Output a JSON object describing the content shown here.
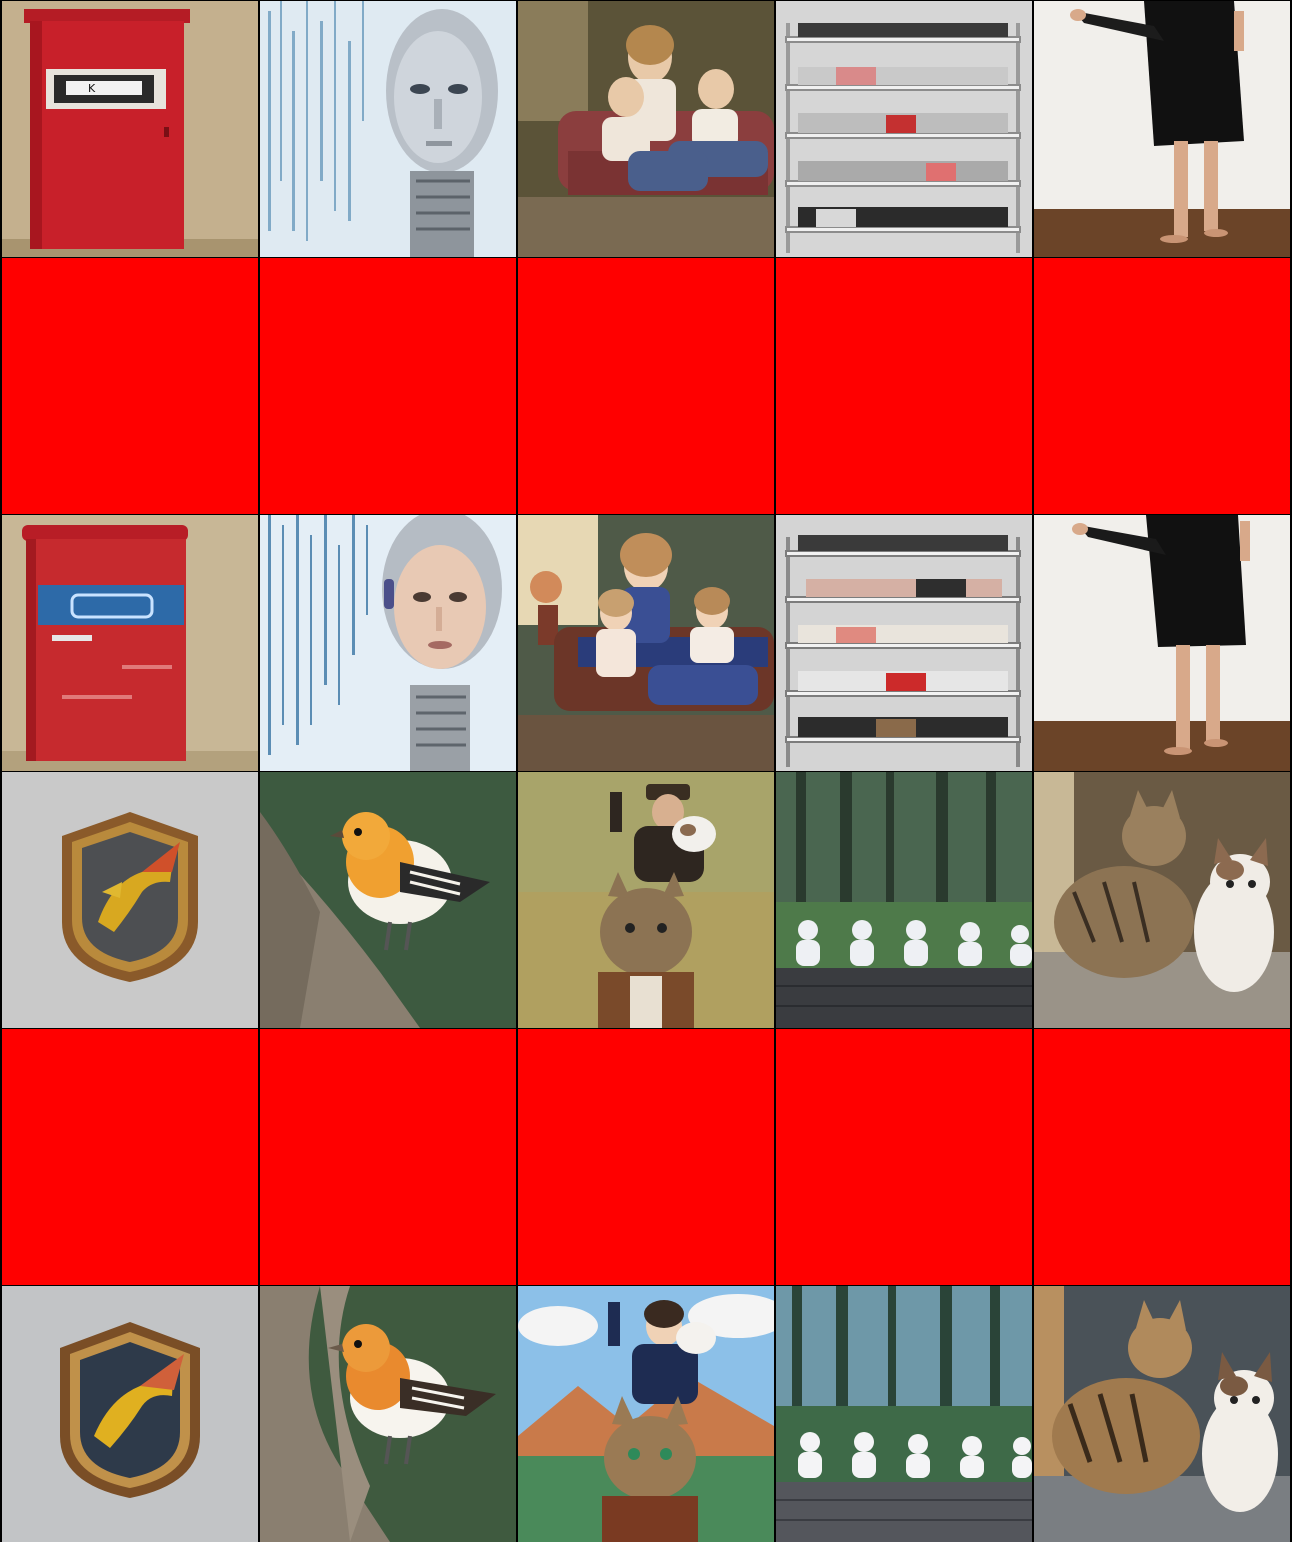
{
  "grid": {
    "rows": 6,
    "cols": 5,
    "background": "#000000",
    "placeholder_color": "#ff0000"
  },
  "tiles": [
    {
      "row": 1,
      "col": 1,
      "subject": "red-mailbox-cabinet",
      "label_text": "K"
    },
    {
      "row": 1,
      "col": 2,
      "subject": "silver-robot-head-binary-code"
    },
    {
      "row": 1,
      "col": 3,
      "subject": "children-on-sofa-painting"
    },
    {
      "row": 1,
      "col": 4,
      "subject": "shoe-rack"
    },
    {
      "row": 1,
      "col": 5,
      "subject": "person-black-dress"
    },
    {
      "row": 2,
      "col": 1,
      "subject": "red-placeholder"
    },
    {
      "row": 2,
      "col": 2,
      "subject": "red-placeholder"
    },
    {
      "row": 2,
      "col": 3,
      "subject": "red-placeholder"
    },
    {
      "row": 2,
      "col": 4,
      "subject": "red-placeholder"
    },
    {
      "row": 2,
      "col": 5,
      "subject": "red-placeholder"
    },
    {
      "row": 3,
      "col": 1,
      "subject": "red-mailbox-cabinet-blue-band"
    },
    {
      "row": 3,
      "col": 2,
      "subject": "humanoid-robot-face-binary-code"
    },
    {
      "row": 3,
      "col": 3,
      "subject": "children-on-sofa-anime"
    },
    {
      "row": 3,
      "col": 4,
      "subject": "shoe-rack"
    },
    {
      "row": 3,
      "col": 5,
      "subject": "person-black-dress"
    },
    {
      "row": 4,
      "col": 1,
      "subject": "dragon-shield-emblem"
    },
    {
      "row": 4,
      "col": 2,
      "subject": "orange-bird-on-rock"
    },
    {
      "row": 4,
      "col": 3,
      "subject": "man-with-cats-painting"
    },
    {
      "row": 4,
      "col": 4,
      "subject": "robots-meditating-forest"
    },
    {
      "row": 4,
      "col": 5,
      "subject": "two-cats"
    },
    {
      "row": 5,
      "col": 1,
      "subject": "red-placeholder"
    },
    {
      "row": 5,
      "col": 2,
      "subject": "red-placeholder"
    },
    {
      "row": 5,
      "col": 3,
      "subject": "red-placeholder"
    },
    {
      "row": 5,
      "col": 4,
      "subject": "red-placeholder"
    },
    {
      "row": 5,
      "col": 5,
      "subject": "red-placeholder"
    },
    {
      "row": 6,
      "col": 1,
      "subject": "dragon-shield-emblem"
    },
    {
      "row": 6,
      "col": 2,
      "subject": "orange-bird-on-rock"
    },
    {
      "row": 6,
      "col": 3,
      "subject": "man-with-cats-anime"
    },
    {
      "row": 6,
      "col": 4,
      "subject": "robots-meditating-forest"
    },
    {
      "row": 6,
      "col": 5,
      "subject": "two-cats"
    }
  ],
  "colors": {
    "mailbox_red": "#c8202a",
    "mailbox_wall": "#c4b08e",
    "robot_silver": "#b9c0c8",
    "code_blue": "#5a8fb5",
    "sofa_room": "#6e5a3e",
    "shelf_gray": "#d9d9d9",
    "dress_black": "#111111",
    "floor_wood": "#7a4a2e",
    "shield_gold": "#b98a3c",
    "bird_orange": "#f0a030",
    "rock_gray": "#8a7f70",
    "forest_green": "#3d5a40",
    "cat_tabby": "#8c7353"
  }
}
